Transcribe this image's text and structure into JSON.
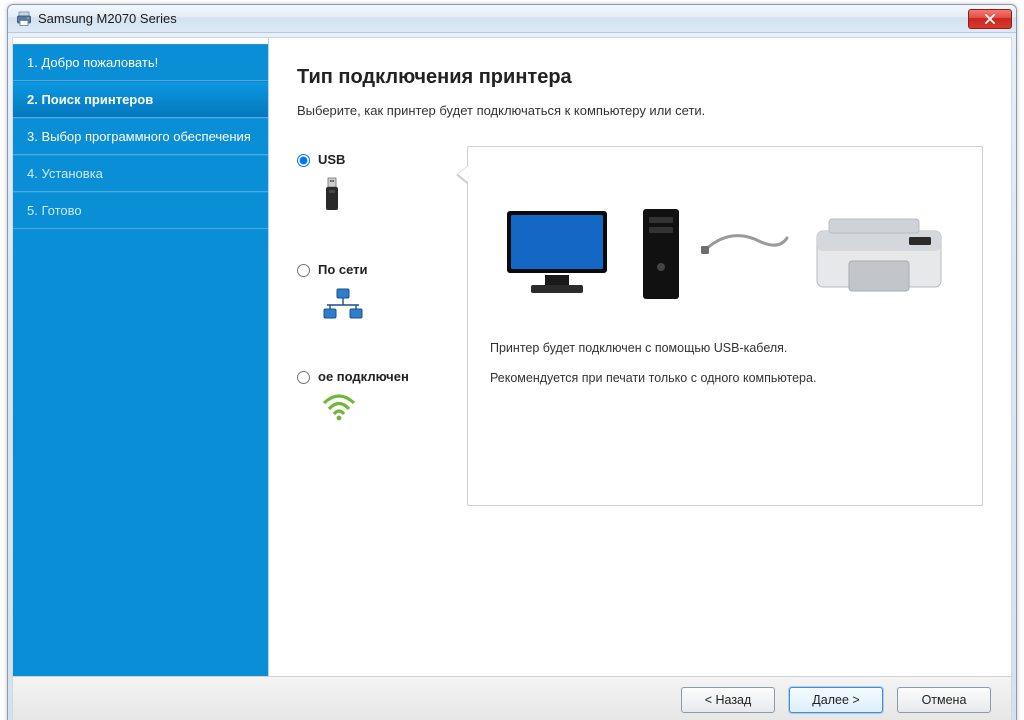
{
  "window": {
    "title": "Samsung M2070 Series"
  },
  "sidebar": {
    "steps": [
      {
        "label": "1. Добро пожаловать!"
      },
      {
        "label": "2. Поиск принтеров"
      },
      {
        "label": "3. Выбор программного обеспечения"
      },
      {
        "label": "4. Установка"
      },
      {
        "label": "5. Готово"
      }
    ],
    "active_index": 1
  },
  "main": {
    "heading": "Тип подключения принтера",
    "subtitle": "Выберите, как принтер будет подключаться к компьютеру или сети."
  },
  "options": {
    "usb": {
      "label": "USB"
    },
    "network": {
      "label": "По сети"
    },
    "wireless": {
      "label": "ое подключен"
    },
    "selected": "usb"
  },
  "detail": {
    "line1": "Принтер будет подключен с помощью USB-кабеля.",
    "line2": "Рекомендуется при печати только с одного компьютера."
  },
  "footer": {
    "back": "< Назад",
    "next": "Далее >",
    "cancel": "Отмена"
  },
  "icons": {
    "app": "printer-icon",
    "close": "close-icon",
    "usb": "usb-stick-icon",
    "network": "network-nodes-icon",
    "wireless": "wifi-icon",
    "monitor": "monitor-icon",
    "tower": "pc-tower-icon",
    "printer": "laser-printer-icon"
  }
}
